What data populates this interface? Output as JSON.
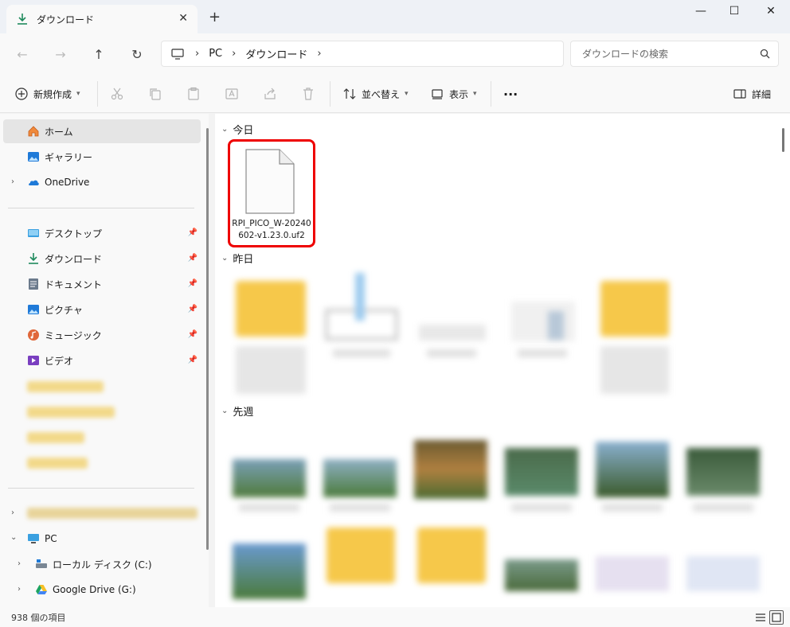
{
  "tab": {
    "title": "ダウンロード",
    "close_glyph": "✕",
    "new_tab_glyph": "+"
  },
  "window_controls": {
    "minimize": "—",
    "maximize": "☐",
    "close": "✕"
  },
  "nav": {
    "back": "←",
    "forward": "→",
    "up": "↑",
    "refresh": "↻"
  },
  "breadcrumb": {
    "items": [
      "PC",
      "ダウンロード"
    ],
    "sep": "›"
  },
  "search": {
    "placeholder": "ダウンロードの検索"
  },
  "toolbar": {
    "new_label": "新規作成",
    "sort_label": "並べ替え",
    "view_label": "表示",
    "more_label": "···",
    "details_label": "詳細"
  },
  "sidebar": {
    "home": "ホーム",
    "gallery": "ギャラリー",
    "onedrive": "OneDrive",
    "quick": [
      "デスクトップ",
      "ダウンロード",
      "ドキュメント",
      "ピクチャ",
      "ミュージック",
      "ビデオ"
    ],
    "pc": "PC",
    "drive_c": "ローカル ディスク (C:)",
    "drive_g": "Google Drive (G:)"
  },
  "groups": {
    "today": "今日",
    "yesterday": "昨日",
    "last_week": "先週"
  },
  "file": {
    "name": "RPI_PICO_W-20240602-v1.23.0.uf2"
  },
  "status": {
    "count": "938 個の項目"
  },
  "colors": {
    "accent": "#0067c0",
    "highlight": "#e00000",
    "folder": "#f6c84a"
  }
}
